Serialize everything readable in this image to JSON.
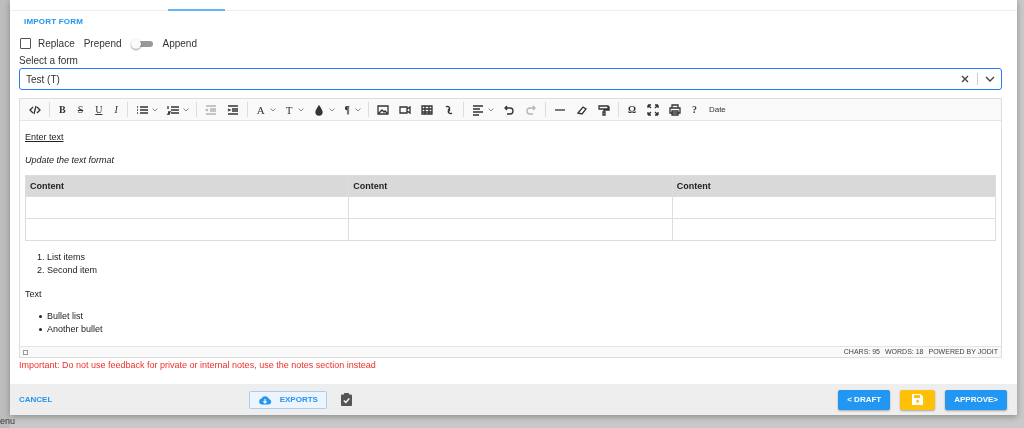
{
  "background": {
    "menu_fragment": "enu"
  },
  "dialog": {
    "tabs_indicator": {
      "selected": true
    },
    "section_title": "IMPORT FORM",
    "options": {
      "replace_label": "Replace",
      "replace_checked": false,
      "prepend_label": "Prepend",
      "append_label": "Append",
      "append_on": false
    },
    "form_select": {
      "label": "Select a form",
      "value": "Test (T)"
    },
    "editor": {
      "toolbar_labels": [
        "B",
        "S",
        "U",
        "I",
        "A",
        "T",
        "¶",
        "Ω",
        "?",
        "Date"
      ],
      "underlined_line": "Enter text",
      "italic_line": "Update the text format",
      "table": {
        "columns": [
          "Content",
          "Content",
          "Content"
        ],
        "rows": [
          [
            "",
            "",
            ""
          ],
          [
            "",
            "",
            ""
          ]
        ]
      },
      "ordered_list": [
        {
          "number": "1.",
          "text": "List items"
        },
        {
          "number": "2.",
          "text": "Second item"
        }
      ],
      "paragraph": "Text",
      "bullet_list": [
        "Bullet list",
        "Another bullet"
      ],
      "status": [
        "CHARS: 95",
        "WORDS: 18",
        "POWERED BY JODIT"
      ]
    },
    "warning": "Important: Do not use feedback for private or internal notes, use the notes section instead",
    "footer": {
      "cancel": "CANCEL",
      "exports": "EXPORTS",
      "draft": "< DRAFT",
      "approve": "APPROVE>"
    }
  }
}
